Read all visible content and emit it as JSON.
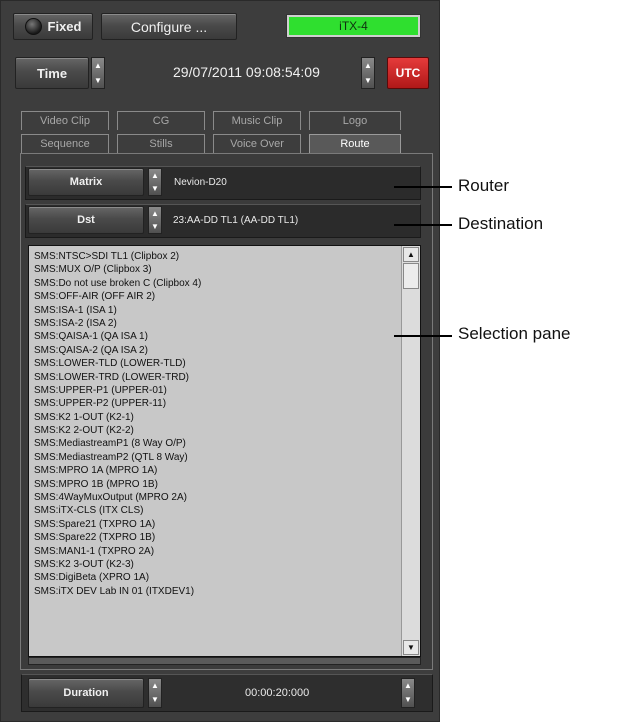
{
  "top_bar": {
    "fixed_label": "Fixed",
    "configure_label": "Configure ...",
    "status_label": "iTX-4",
    "status_color": "#2fdf2f"
  },
  "time_row": {
    "time_label": "Time",
    "datetime": "29/07/2011 09:08:54:09",
    "utc_label": "UTC",
    "utc_color": "#d42a2a"
  },
  "tabs": {
    "row1": [
      "Video Clip",
      "CG",
      "Music Clip",
      "Logo"
    ],
    "row2": [
      "Sequence",
      "Stills",
      "Voice Over",
      "Route"
    ],
    "active": "Route"
  },
  "route": {
    "matrix_label": "Matrix",
    "matrix_value": "Nevion-D20",
    "dst_label": "Dst",
    "dst_value": "23:AA-DD TL1 (AA-DD TL1)"
  },
  "selection_items": [
    "SMS:NTSC>SDI TL1 (Clipbox 2)",
    "SMS:MUX O/P (Clipbox 3)",
    "SMS:Do not use broken C (Clipbox 4)",
    "SMS:OFF-AIR (OFF AIR 2)",
    "SMS:ISA-1 (ISA 1)",
    "SMS:ISA-2 (ISA 2)",
    "SMS:QAISA-1 (QA ISA 1)",
    "SMS:QAISA-2 (QA ISA 2)",
    "SMS:LOWER-TLD (LOWER-TLD)",
    "SMS:LOWER-TRD (LOWER-TRD)",
    "SMS:UPPER-P1 (UPPER-01)",
    "SMS:UPPER-P2 (UPPER-11)",
    "SMS:K2 1-OUT (K2-1)",
    "SMS:K2 2-OUT (K2-2)",
    "SMS:MediastreamP1 (8 Way O/P)",
    "SMS:MediastreamP2 (QTL 8 Way)",
    "SMS:MPRO 1A (MPRO 1A)",
    "SMS:MPRO 1B (MPRO 1B)",
    "SMS:4WayMuxOutput (MPRO 2A)",
    "SMS:iTX-CLS (ITX CLS)",
    "SMS:Spare21 (TXPRO 1A)",
    "SMS:Spare22 (TXPRO 1B)",
    "SMS:MAN1-1 (TXPRO 2A)",
    "SMS:K2 3-OUT (K2-3)",
    "SMS:DigiBeta (XPRO 1A)",
    "SMS:iTX DEV Lab IN 01 (ITXDEV1)"
  ],
  "duration": {
    "label": "Duration",
    "value": "00:00:20:000"
  },
  "callouts": {
    "router": "Router",
    "destination": "Destination",
    "selection_pane": "Selection pane"
  },
  "icons": {
    "spin": "up-down-spinner-icon",
    "led": "led-indicator-icon",
    "scroll_up": "scroll-up-arrow-icon",
    "scroll_down": "scroll-down-arrow-icon"
  }
}
